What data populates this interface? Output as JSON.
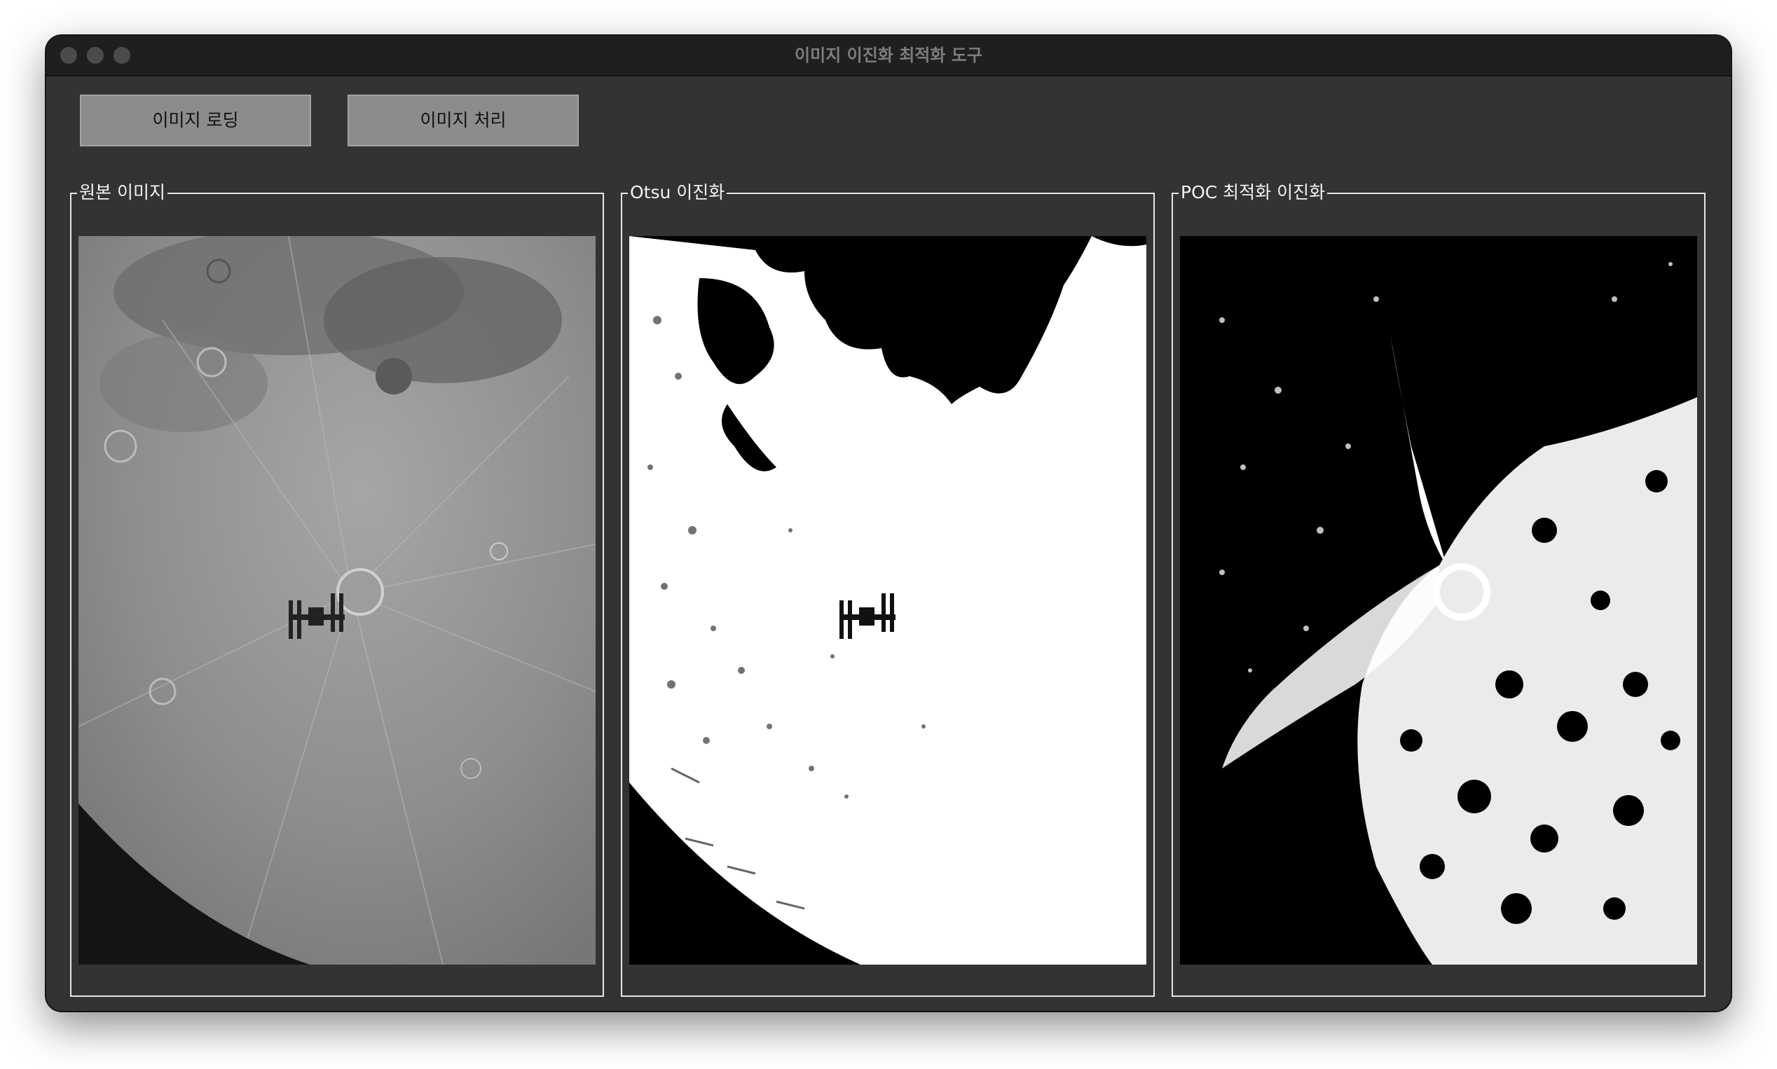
{
  "window": {
    "title": "이미지 이진화 최적화 도구"
  },
  "toolbar": {
    "load_label": "이미지 로딩",
    "process_label": "이미지 처리"
  },
  "panels": [
    {
      "label": "원본 이미지"
    },
    {
      "label": "Otsu 이진화"
    },
    {
      "label": "POC 최적화 이진화"
    }
  ],
  "colors": {
    "window_bg": "#333333",
    "titlebar_bg": "#1f1f1f",
    "button_bg": "#8c8c8c",
    "panel_border": "#e6e6e6"
  }
}
